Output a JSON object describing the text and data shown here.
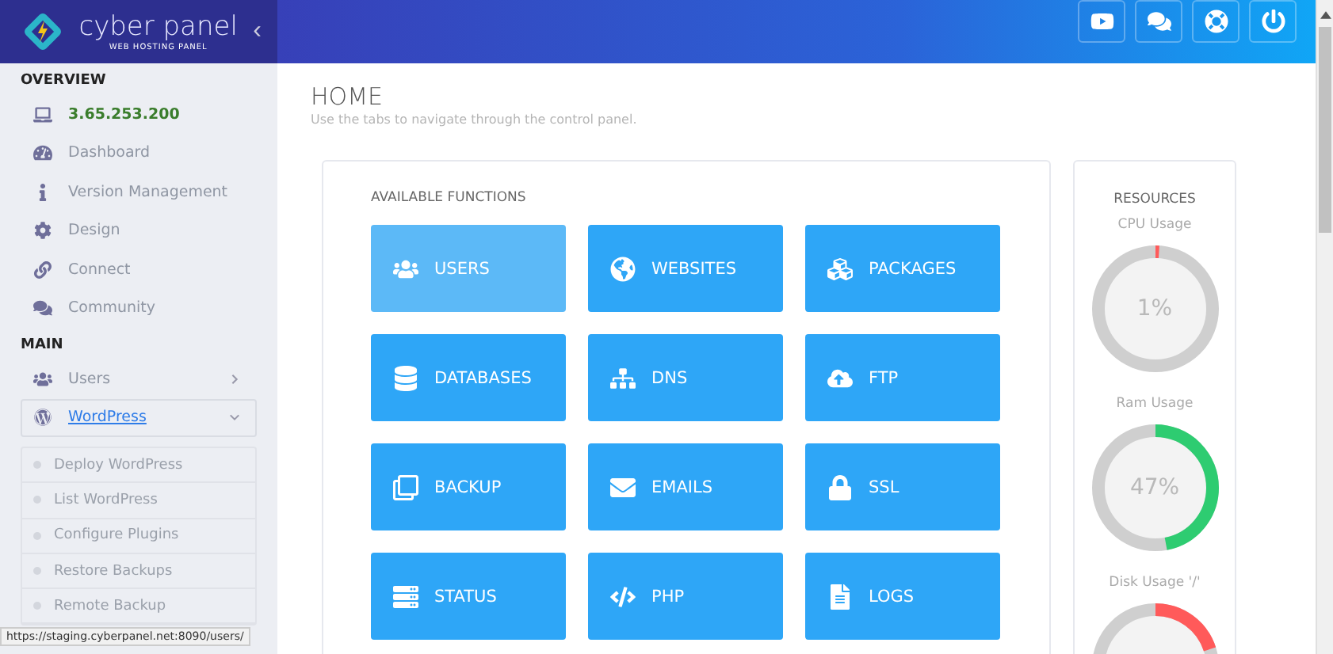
{
  "brand": {
    "name": "cyber panel",
    "tagline": "WEB HOSTING PANEL",
    "collapse": "‹"
  },
  "header_buttons": [
    {
      "kind": "youtube"
    },
    {
      "kind": "chat"
    },
    {
      "kind": "support"
    },
    {
      "kind": "power"
    }
  ],
  "sidebar": {
    "sections": [
      {
        "title": "OVERVIEW",
        "items": [
          {
            "label": "3.65.253.200",
            "kind": "host"
          },
          {
            "label": "Dashboard",
            "kind": "link"
          },
          {
            "label": "Version Management",
            "kind": "link"
          },
          {
            "label": "Design",
            "kind": "link"
          },
          {
            "label": "Connect",
            "kind": "link"
          },
          {
            "label": "Community",
            "kind": "link"
          }
        ]
      },
      {
        "title": "MAIN",
        "items": [
          {
            "label": "Users",
            "kind": "menu",
            "expanded": false
          },
          {
            "label": "WordPress",
            "kind": "menu",
            "expanded": true,
            "children": [
              {
                "label": "Deploy WordPress"
              },
              {
                "label": "List WordPress"
              },
              {
                "label": "Configure Plugins"
              },
              {
                "label": "Restore Backups"
              },
              {
                "label": "Remote Backup"
              }
            ]
          }
        ]
      }
    ]
  },
  "page": {
    "title": "HOME",
    "subtitle": "Use the tabs to navigate through the control panel."
  },
  "functions": {
    "title": "AVAILABLE FUNCTIONS",
    "tiles": [
      {
        "label": "USERS",
        "highlighted": true
      },
      {
        "label": "WEBSITES",
        "highlighted": false
      },
      {
        "label": "PACKAGES",
        "highlighted": false
      },
      {
        "label": "DATABASES",
        "highlighted": false
      },
      {
        "label": "DNS",
        "highlighted": false
      },
      {
        "label": "FTP",
        "highlighted": false
      },
      {
        "label": "BACKUP",
        "highlighted": false
      },
      {
        "label": "EMAILS",
        "highlighted": false
      },
      {
        "label": "SSL",
        "highlighted": false
      },
      {
        "label": "STATUS",
        "highlighted": false
      },
      {
        "label": "PHP",
        "highlighted": false
      },
      {
        "label": "LOGS",
        "highlighted": false
      }
    ]
  },
  "resources": {
    "title": "RESOURCES",
    "gauges": [
      {
        "label": "CPU Usage",
        "reading": "1%",
        "level": 0.01,
        "color": "#ff5a5a"
      },
      {
        "label": "Ram Usage",
        "reading": "47%",
        "level": 0.47,
        "color": "#2ecc71"
      },
      {
        "label": "Disk Usage '/'",
        "level": 0.2,
        "color": "#ff5a5a"
      }
    ]
  },
  "status_url": "https://staging.cyberpanel.net:8090/users/"
}
